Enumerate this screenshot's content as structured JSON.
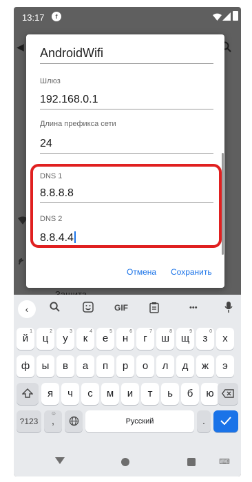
{
  "status_bar": {
    "time": "13:17",
    "app_badge": "f"
  },
  "background": {
    "item_label": "Защита"
  },
  "dialog": {
    "title": "AndroidWifi",
    "fields": [
      {
        "label": "Шлюз",
        "value": "192.168.0.1"
      },
      {
        "label": "Длина префикса сети",
        "value": "24"
      },
      {
        "label": "DNS 1",
        "value": "8.8.8.8"
      },
      {
        "label": "DNS 2",
        "value": "8.8.4.4"
      }
    ],
    "cancel_label": "Отмена",
    "save_label": "Сохранить"
  },
  "keyboard": {
    "toolbar": {
      "gif_label": "GIF",
      "more_label": "•••"
    },
    "row1": [
      {
        "char": "й",
        "hint": "1"
      },
      {
        "char": "ц",
        "hint": "2"
      },
      {
        "char": "у",
        "hint": "3"
      },
      {
        "char": "к",
        "hint": "4"
      },
      {
        "char": "е",
        "hint": "5"
      },
      {
        "char": "н",
        "hint": "6"
      },
      {
        "char": "г",
        "hint": "7"
      },
      {
        "char": "ш",
        "hint": "8"
      },
      {
        "char": "щ",
        "hint": "9"
      },
      {
        "char": "з",
        "hint": "0"
      },
      {
        "char": "х",
        "hint": ""
      }
    ],
    "row2": [
      "ф",
      "ы",
      "в",
      "а",
      "п",
      "р",
      "о",
      "л",
      "д",
      "ж",
      "э"
    ],
    "row3": [
      "я",
      "ч",
      "с",
      "м",
      "и",
      "т",
      "ь",
      "б",
      "ю"
    ],
    "symbols_label": "?123",
    "comma_label": ",",
    "space_label": "Русский",
    "period_label": "."
  },
  "colors": {
    "accent": "#1a73e8",
    "highlight": "#e02020"
  }
}
